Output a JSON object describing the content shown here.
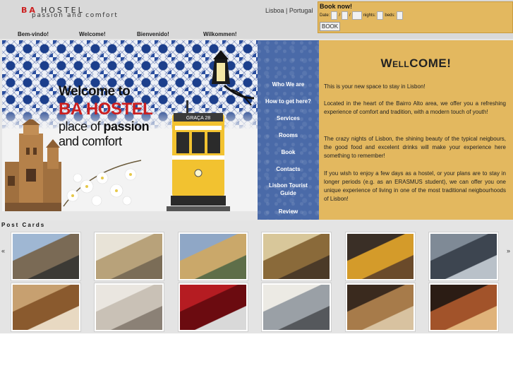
{
  "header": {
    "brand_ba": "BA",
    "brand_hostel": "HOSTEL",
    "tagline": "passion and comfort",
    "city": "Lisboa | Portugal"
  },
  "booking": {
    "title": "Book now!",
    "date_label": "Date:",
    "sep1": "/",
    "sep2": "/",
    "nights_label": "nights:",
    "beds_label": "beds:",
    "button": "BOOK"
  },
  "languages": [
    {
      "label": "Bem-vindo!"
    },
    {
      "label": "Welcome!"
    },
    {
      "label": "Bienvenido!"
    },
    {
      "label": "Wilkommen!"
    }
  ],
  "hero": {
    "welcome": "Welcome to",
    "brand": "BA HOSTEL",
    "line1_pre": "place of ",
    "line1_bold": "passion",
    "line2": "and comfort",
    "tram_sign": "GRAÇA 28"
  },
  "nav": [
    {
      "label": "Who We are"
    },
    {
      "label": "How to get here?"
    },
    {
      "label": "Services"
    },
    {
      "label": "Rooms"
    },
    {
      "label": "Book"
    },
    {
      "label": "Contacts"
    },
    {
      "label": "Lisbon Tourist Guide"
    },
    {
      "label": "Review"
    }
  ],
  "content": {
    "title_cap1": "W",
    "title_small": "ELL",
    "title_rest": "COME!",
    "paragraphs": [
      "This is your new space to stay in Lisbon!",
      "Located in the heart of the Bairro Alto area, we offer you a refreshing experience of comfort and tradition, with a modern touch of youth!",
      "The crazy nights of Lisbon, the shining beauty of the typical neigbours, the good food and excelent drinks will make your experience here something to remember!",
      "If you wish to enjoy a few days as a hostel, or your plans are to stay in longer periods (e.g. as an ERASMUS student), we can offer you one unique experience of living in one of the most traditional neigbourhoods of Lisbon!"
    ]
  },
  "postcards": {
    "title": "Post Cards",
    "prev": "«",
    "next": "»",
    "rows": [
      [
        {
          "icon": "city-view-photo",
          "colors": [
            "#9fb7d3",
            "#7a6a55",
            "#3c3a35"
          ]
        },
        {
          "icon": "street-photo",
          "colors": [
            "#e8e3d7",
            "#b8a27a",
            "#7b6d57"
          ]
        },
        {
          "icon": "rooftops-photo",
          "colors": [
            "#8fa7c6",
            "#caa86a",
            "#5e6e49"
          ]
        },
        {
          "icon": "alley-photo",
          "colors": [
            "#d8c79a",
            "#8a6a3a",
            "#4b3a28"
          ]
        },
        {
          "icon": "tram-photo",
          "colors": [
            "#3a2f26",
            "#d49b2a",
            "#6a4a2a"
          ]
        },
        {
          "icon": "kitchen-photo",
          "colors": [
            "#7f8a96",
            "#3d4550",
            "#b9c1c9"
          ]
        }
      ],
      [
        {
          "icon": "bedroom-photo",
          "colors": [
            "#c7a070",
            "#8a5a2e",
            "#e8d9c2"
          ]
        },
        {
          "icon": "bed-photo",
          "colors": [
            "#eae6e0",
            "#c9c1b6",
            "#8b8176"
          ]
        },
        {
          "icon": "red-sink-photo",
          "colors": [
            "#b51c22",
            "#6b0b10",
            "#d9d9d9"
          ]
        },
        {
          "icon": "bathroom-photo",
          "colors": [
            "#eceae4",
            "#9aa0a6",
            "#55585c"
          ]
        },
        {
          "icon": "bunk-bed-photo",
          "colors": [
            "#3a2a1e",
            "#a77b4a",
            "#d8c2a0"
          ]
        },
        {
          "icon": "lounge-photo",
          "colors": [
            "#2b1c14",
            "#a2532a",
            "#e0b37a"
          ]
        }
      ]
    ]
  },
  "colors": {
    "gold": "#e3b85f",
    "nav_blue": "#4a6aa8",
    "brand_red": "#cc1f1f",
    "header_gray": "#d9d9d9"
  }
}
